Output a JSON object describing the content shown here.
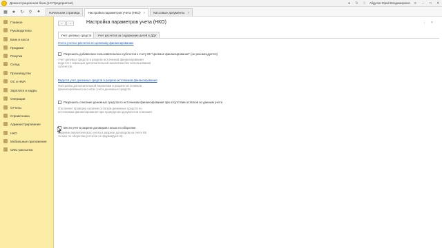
{
  "titlebar": {
    "app_title": "Демонстрационная база  (1С:Предприятие)",
    "user": "Абдулов Юрий Владимирович"
  },
  "toolbar": {
    "tools": [
      "grid-icon",
      "star-icon",
      "history-icon",
      "search-icon",
      "bell-icon"
    ]
  },
  "tabs": [
    {
      "label": "Начальная страница",
      "active": false,
      "closable": false
    },
    {
      "label": "Настройка параметров учета (НКО)",
      "active": true,
      "closable": true
    },
    {
      "label": "Кассовые документы",
      "active": false,
      "closable": true
    }
  ],
  "sidebar": {
    "items": [
      {
        "label": "Главное",
        "icon": "home-icon"
      },
      {
        "label": "Руководителю",
        "icon": "chart-icon"
      },
      {
        "label": "Банк и касса",
        "icon": "bank-icon"
      },
      {
        "label": "Продажи",
        "icon": "cart-icon"
      },
      {
        "label": "Покупки",
        "icon": "basket-icon"
      },
      {
        "label": "Склад",
        "icon": "warehouse-icon"
      },
      {
        "label": "Производство",
        "icon": "factory-icon"
      },
      {
        "label": "ОС и НМА",
        "icon": "assets-icon"
      },
      {
        "label": "Зарплата и кадры",
        "icon": "people-icon"
      },
      {
        "label": "Операции",
        "icon": "operations-icon"
      },
      {
        "label": "Отчеты",
        "icon": "reports-icon"
      },
      {
        "label": "Справочники",
        "icon": "book-icon"
      },
      {
        "label": "Администрирование",
        "icon": "gear-icon"
      },
      {
        "label": "НКО",
        "icon": "nko-icon"
      },
      {
        "label": "Мобильные приложения",
        "icon": "mobile-icon"
      },
      {
        "label": "СМС-рассылка",
        "icon": "sms-icon"
      }
    ]
  },
  "main": {
    "page_title": "Настройка параметров учета (НКО)",
    "back_icon": "arrow-left-icon",
    "forward_icon": "arrow-right-icon",
    "form_tabs": [
      {
        "label": "Учет целевых средств",
        "active": true
      },
      {
        "label": "Учет расчетов за содержание детей в ДДУ",
        "active": false
      }
    ],
    "section_link_1": "Счета учета и расчетов по целевому финансированию",
    "option_1": {
      "label": "Разрешить добавление пользовательских субсчетов к счету 86 \"Целевое финансирование\" (не рекомендуется)",
      "checked": false
    },
    "desc_1": "Учет целевых средств в разрезе источников финансирования ведется с помощью дополнительной аналитики без использования субсчетов.",
    "section_link_2": "Ведется учет денежных средств в разрезе источников финансирования",
    "desc_2": "Настройка дополнительной аналитики в разрезе источников финансирования на счетах учета денежных средств.",
    "option_2": {
      "label": "Разрешить списание денежных средств по источникам финансирования при отсутствии остатков по данным учета",
      "checked": false
    },
    "desc_3": "Отключает проверку наличия остатков денежных средств по источникам финансирования при проведении документов списания.",
    "option_3": {
      "label": "Вести учет в разрезе договоров только по оборотам",
      "checked": false
    },
    "desc_4": "Ведение аналитического учета в разрезе договоров на счете 86 только по оборотам (остатки не формируются)."
  }
}
